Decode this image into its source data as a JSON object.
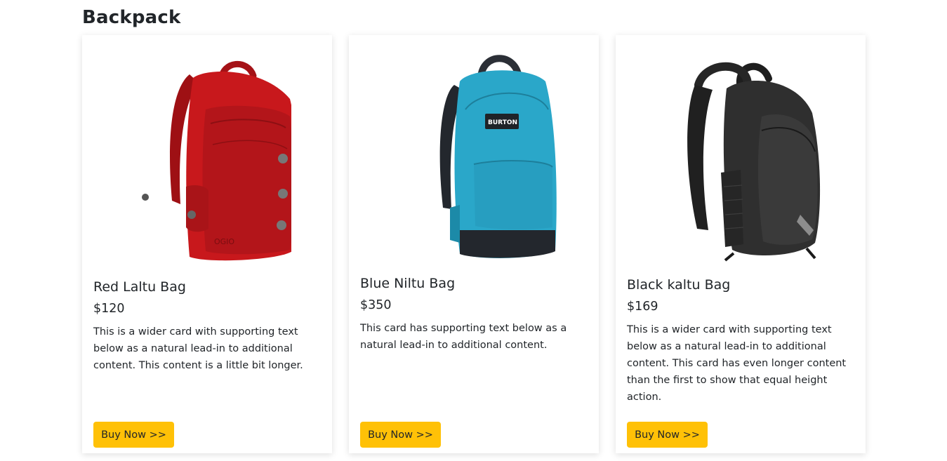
{
  "page": {
    "title": "Backpack"
  },
  "colors": {
    "button": "#ffc107",
    "red_bag": "#c8181c",
    "blue_bag": "#2aa7c9",
    "black_bag": "#2f2f2f"
  },
  "products": [
    {
      "name": "Red Laltu Bag",
      "price": "$120",
      "description": "This is a wider card with supporting text below as a natural lead-in to additional content. This content is a little bit longer.",
      "button_label": "Buy Now >>",
      "image_icon": "red-backpack-image",
      "image_logo": "OGIO"
    },
    {
      "name": "Blue Niltu Bag",
      "price": "$350",
      "description": "This card has supporting text below as a natural lead-in to additional content.",
      "button_label": "Buy Now >>",
      "image_icon": "blue-backpack-image",
      "image_logo": "BURTON"
    },
    {
      "name": "Black kaltu Bag",
      "price": "$169",
      "description": "This is a wider card with supporting text below as a natural lead-in to additional content. This card has even longer content than the first to show that equal height action.",
      "button_label": "Buy Now >>",
      "image_icon": "black-backpack-image"
    }
  ]
}
